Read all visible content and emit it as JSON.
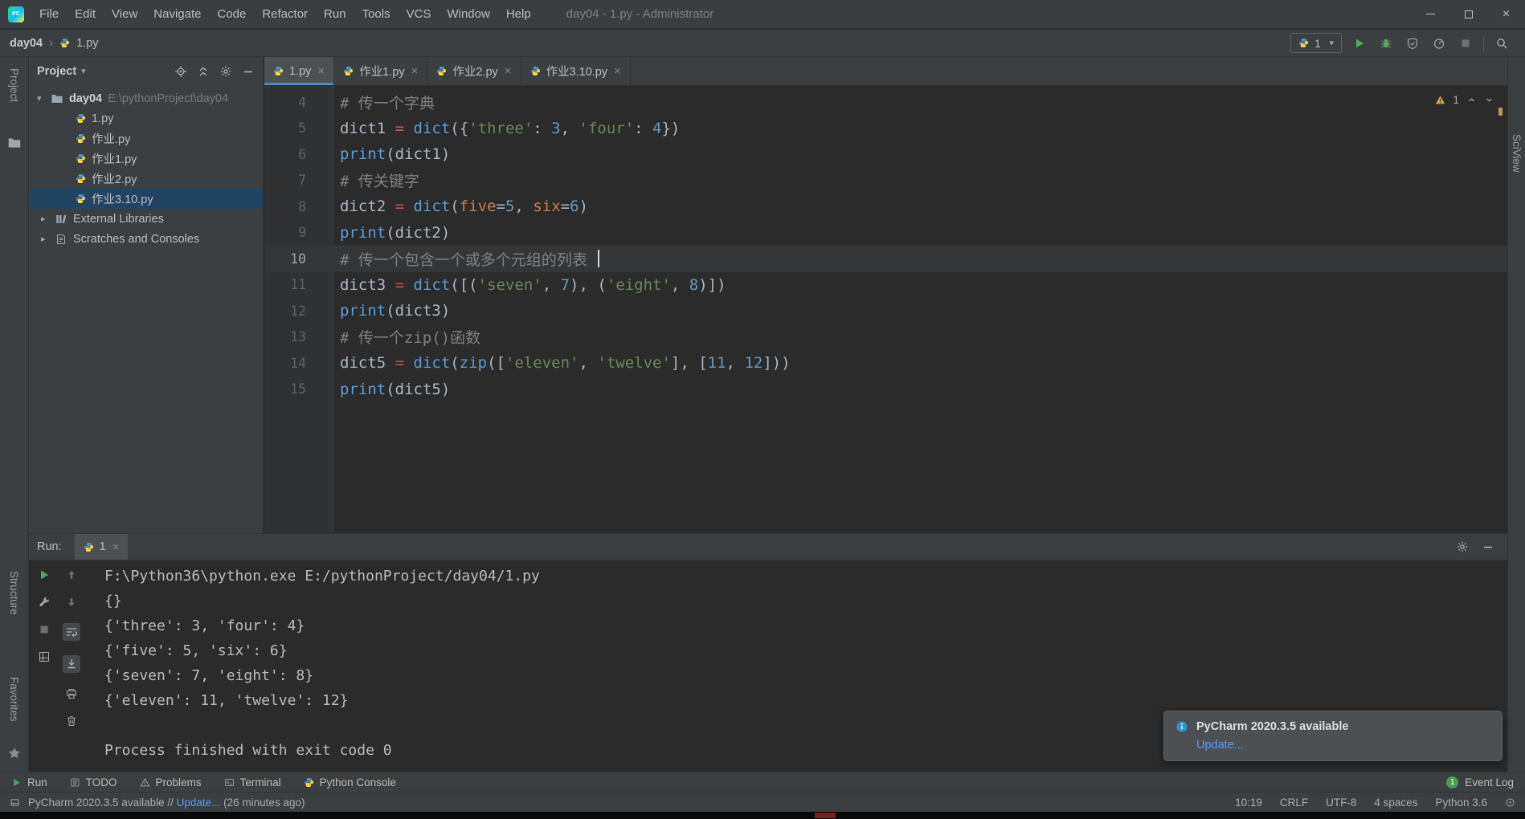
{
  "window": {
    "title": "day04 - 1.py - Administrator",
    "logo_text": "PC",
    "menus": [
      "File",
      "Edit",
      "View",
      "Navigate",
      "Code",
      "Refactor",
      "Run",
      "Tools",
      "VCS",
      "Window",
      "Help"
    ]
  },
  "icons": {
    "close": "×",
    "dropdown": "▾",
    "breadcrumb_sep": "›",
    "chevron_expanded": "▾",
    "chevron_collapsed": "▸"
  },
  "toolbar": {
    "breadcrumbs": [
      "day04",
      "1.py"
    ],
    "run_config": "1"
  },
  "stripes": {
    "left": [
      "Project",
      "Structure",
      "Favorites"
    ],
    "right": [
      "SciView"
    ]
  },
  "project_panel": {
    "title": "Project",
    "root_name": "day04",
    "root_path": "E:\\pythonProject\\day04",
    "files": [
      "1.py",
      "作业.py",
      "作业1.py",
      "作业2.py",
      "作业3.10.py"
    ],
    "selected_index": 4,
    "special": [
      "External Libraries",
      "Scratches and Consoles"
    ]
  },
  "tabs": [
    {
      "label": "1.py",
      "active": true
    },
    {
      "label": "作业1.py",
      "active": false
    },
    {
      "label": "作业2.py",
      "active": false
    },
    {
      "label": "作业3.10.py",
      "active": false
    }
  ],
  "editor": {
    "warning_count": "1",
    "current_line": 10,
    "token_colors": {
      "plain": "#A9B7C6",
      "comment": "#808080",
      "string": "#6A8759",
      "number": "#6897BB",
      "builtin": "#5C9BD6",
      "assign": "#C75450",
      "kwarg": "#C77F4F"
    },
    "lines": [
      {
        "num": 4,
        "tokens": [
          {
            "t": "# 传一个字典",
            "c": "comment"
          }
        ]
      },
      {
        "num": 5,
        "tokens": [
          {
            "t": "dict1 ",
            "c": "plain"
          },
          {
            "t": "= ",
            "c": "assign"
          },
          {
            "t": "dict",
            "c": "builtin"
          },
          {
            "t": "({",
            "c": "plain"
          },
          {
            "t": "'three'",
            "c": "string"
          },
          {
            "t": ": ",
            "c": "plain"
          },
          {
            "t": "3",
            "c": "number"
          },
          {
            "t": ", ",
            "c": "plain"
          },
          {
            "t": "'four'",
            "c": "string"
          },
          {
            "t": ": ",
            "c": "plain"
          },
          {
            "t": "4",
            "c": "number"
          },
          {
            "t": "})",
            "c": "plain"
          }
        ]
      },
      {
        "num": 6,
        "tokens": [
          {
            "t": "print",
            "c": "builtin"
          },
          {
            "t": "(dict1)",
            "c": "plain"
          }
        ]
      },
      {
        "num": 7,
        "tokens": [
          {
            "t": "# 传关键字",
            "c": "comment"
          }
        ]
      },
      {
        "num": 8,
        "tokens": [
          {
            "t": "dict2 ",
            "c": "plain"
          },
          {
            "t": "= ",
            "c": "assign"
          },
          {
            "t": "dict",
            "c": "builtin"
          },
          {
            "t": "(",
            "c": "plain"
          },
          {
            "t": "five",
            "c": "kwarg"
          },
          {
            "t": "=",
            "c": "plain"
          },
          {
            "t": "5",
            "c": "number"
          },
          {
            "t": ", ",
            "c": "plain"
          },
          {
            "t": "six",
            "c": "kwarg"
          },
          {
            "t": "=",
            "c": "plain"
          },
          {
            "t": "6",
            "c": "number"
          },
          {
            "t": ")",
            "c": "plain"
          }
        ]
      },
      {
        "num": 9,
        "tokens": [
          {
            "t": "print",
            "c": "builtin"
          },
          {
            "t": "(dict2)",
            "c": "plain"
          }
        ]
      },
      {
        "num": 10,
        "caret": true,
        "tokens": [
          {
            "t": "# 传一个包含一个或多个元组的列表 ",
            "c": "comment"
          }
        ]
      },
      {
        "num": 11,
        "tokens": [
          {
            "t": "dict3 ",
            "c": "plain"
          },
          {
            "t": "= ",
            "c": "assign"
          },
          {
            "t": "dict",
            "c": "builtin"
          },
          {
            "t": "([(",
            "c": "plain"
          },
          {
            "t": "'seven'",
            "c": "string"
          },
          {
            "t": ", ",
            "c": "plain"
          },
          {
            "t": "7",
            "c": "number"
          },
          {
            "t": "), (",
            "c": "plain"
          },
          {
            "t": "'eight'",
            "c": "string"
          },
          {
            "t": ", ",
            "c": "plain"
          },
          {
            "t": "8",
            "c": "number"
          },
          {
            "t": ")])",
            "c": "plain"
          }
        ]
      },
      {
        "num": 12,
        "tokens": [
          {
            "t": "print",
            "c": "builtin"
          },
          {
            "t": "(dict3)",
            "c": "plain"
          }
        ]
      },
      {
        "num": 13,
        "tokens": [
          {
            "t": "# 传一个zip()函数",
            "c": "comment"
          }
        ]
      },
      {
        "num": 14,
        "tokens": [
          {
            "t": "dict5 ",
            "c": "plain"
          },
          {
            "t": "= ",
            "c": "assign"
          },
          {
            "t": "dict",
            "c": "builtin"
          },
          {
            "t": "(",
            "c": "plain"
          },
          {
            "t": "zip",
            "c": "builtin"
          },
          {
            "t": "([",
            "c": "plain"
          },
          {
            "t": "'eleven'",
            "c": "string"
          },
          {
            "t": ", ",
            "c": "plain"
          },
          {
            "t": "'twelve'",
            "c": "string"
          },
          {
            "t": "], [",
            "c": "plain"
          },
          {
            "t": "11",
            "c": "number"
          },
          {
            "t": ", ",
            "c": "plain"
          },
          {
            "t": "12",
            "c": "number"
          },
          {
            "t": "]))",
            "c": "plain"
          }
        ]
      },
      {
        "num": 15,
        "tokens": [
          {
            "t": "print",
            "c": "builtin"
          },
          {
            "t": "(dict5)",
            "c": "plain"
          }
        ]
      }
    ]
  },
  "run": {
    "label": "Run:",
    "tab": "1",
    "console": [
      "F:\\Python36\\python.exe E:/pythonProject/day04/1.py",
      "{}",
      "{'three': 3, 'four': 4}",
      "{'five': 5, 'six': 6}",
      "{'seven': 7, 'eight': 8}",
      "{'eleven': 11, 'twelve': 12}",
      "",
      "Process finished with exit code 0"
    ]
  },
  "notification": {
    "title": "PyCharm 2020.3.5 available",
    "action": "Update..."
  },
  "bottom_bar": {
    "items": [
      {
        "label": "Run",
        "icon": "play"
      },
      {
        "label": "TODO",
        "icon": "todo"
      },
      {
        "label": "Problems",
        "icon": "problems"
      },
      {
        "label": "Terminal",
        "icon": "terminal"
      },
      {
        "label": "Python Console",
        "icon": "py"
      }
    ],
    "event_log": {
      "badge": "1",
      "label": "Event Log"
    }
  },
  "status_bar": {
    "message_prefix": "PyCharm 2020.3.5 available // ",
    "message_link": "Update...",
    "message_suffix": " (26 minutes ago)",
    "caret_position": "10:19",
    "line_ending": "CRLF",
    "encoding": "UTF-8",
    "indent": "4 spaces",
    "interpreter": "Python 3.6"
  },
  "colors": {
    "accent_blue": "#4A88C7",
    "tree_selection": "#204563",
    "link_blue": "#589DF6",
    "run_green": "#4FA85C",
    "warning_yellow": "#D9A343"
  }
}
